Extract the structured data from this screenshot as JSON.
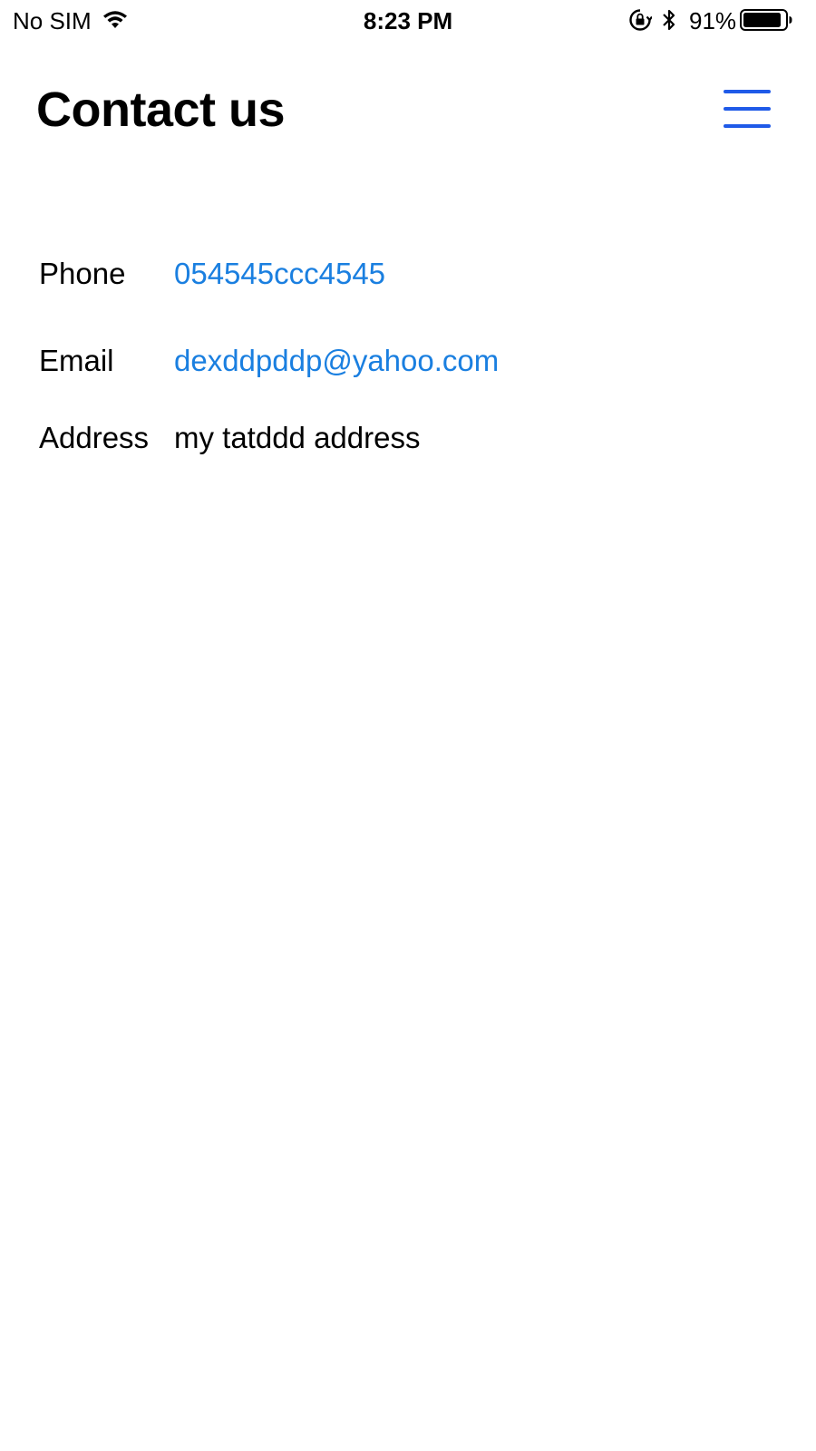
{
  "status_bar": {
    "carrier": "No SIM",
    "time": "8:23 PM",
    "battery_percent": "91%",
    "battery_level": 0.91,
    "icons": [
      "wifi-icon",
      "orientation-lock-icon",
      "bluetooth-icon",
      "battery-icon"
    ]
  },
  "header": {
    "title": "Contact us",
    "menu_icon": "hamburger-menu-icon"
  },
  "contact": {
    "rows": [
      {
        "label": "Phone",
        "value": "054545ccc4545"
      },
      {
        "label": "Email",
        "value": "dexddpddp@yahoo.com"
      },
      {
        "label": "Address",
        "value": "my tatddd address"
      }
    ]
  },
  "colors": {
    "link": "#1a7fe0",
    "menu_icon": "#1f5ae8",
    "text": "#000000",
    "background": "#ffffff"
  }
}
